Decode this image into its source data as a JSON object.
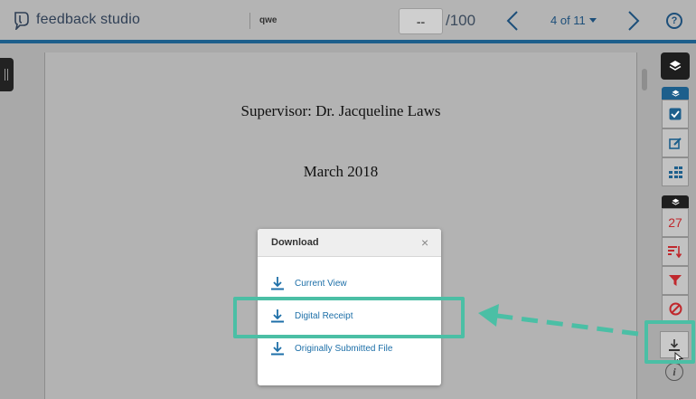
{
  "app": {
    "name": "feedback studio",
    "document_title": "qwe"
  },
  "grade": {
    "value": "--",
    "total": "/100"
  },
  "pagination": {
    "label": "4 of 11"
  },
  "document": {
    "lines": [
      "Supervisor: Dr. Jacqueline Laws",
      "March 2018"
    ]
  },
  "rail": {
    "flag_count": "27"
  },
  "dialog": {
    "title": "Download",
    "close": "×",
    "items": [
      {
        "label": "Current View",
        "icon": "download-icon"
      },
      {
        "label": "Digital Receipt",
        "icon": "download-icon"
      },
      {
        "label": "Originally Submitted File",
        "icon": "download-icon"
      }
    ]
  },
  "colors": {
    "brand_blue": "#1d5f8c",
    "link_blue": "#1d6fa8",
    "alert_red": "#c0282d",
    "highlight_teal": "#4bbfa5"
  }
}
